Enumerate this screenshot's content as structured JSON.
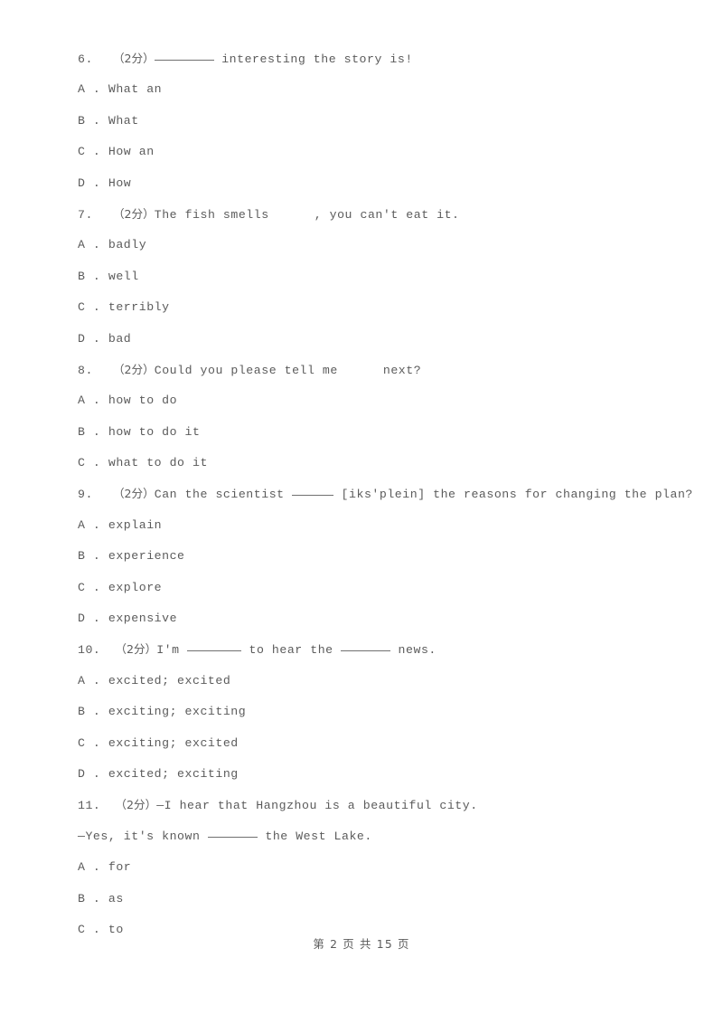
{
  "document": {
    "type": "exam-paper",
    "language": "zh-CN/en",
    "background_color": "#ffffff",
    "text_color": "#5b5b5b"
  },
  "questions": [
    {
      "number": "6.",
      "marks": "（2分）",
      "stem_before": "",
      "blank": "underline",
      "stem_after": " interesting the story is!",
      "options": [
        {
          "letter": "A",
          "sep": " . ",
          "text": "What an"
        },
        {
          "letter": "B",
          "sep": " . ",
          "text": "What"
        },
        {
          "letter": "C",
          "sep": " . ",
          "text": "How an"
        },
        {
          "letter": "D",
          "sep": " . ",
          "text": "How"
        }
      ]
    },
    {
      "number": "7.",
      "marks": "（2分）",
      "stem_before": "The fish smells",
      "blank": "space",
      "stem_after": ", you can't eat it.",
      "options": [
        {
          "letter": "A",
          "sep": " . ",
          "text": "badly"
        },
        {
          "letter": "B",
          "sep": " . ",
          "text": "well"
        },
        {
          "letter": "C",
          "sep": " . ",
          "text": "terribly"
        },
        {
          "letter": "D",
          "sep": " . ",
          "text": "bad"
        }
      ]
    },
    {
      "number": "8.",
      "marks": "（2分）",
      "stem_before": "Could you please tell me",
      "blank": "space",
      "stem_after": "next?",
      "options": [
        {
          "letter": "A",
          "sep": " . ",
          "text": "how to do"
        },
        {
          "letter": "B",
          "sep": " . ",
          "text": "how to do it"
        },
        {
          "letter": "C",
          "sep": " . ",
          "text": "what to do it"
        }
      ]
    },
    {
      "number": "9.",
      "marks": "（2分）",
      "stem_before": "Can the scientist ",
      "blank": "underline",
      "stem_after": " [iks'plein] the reasons for changing the plan?",
      "options": [
        {
          "letter": "A",
          "sep": " . ",
          "text": "explain"
        },
        {
          "letter": "B",
          "sep": " . ",
          "text": "experience"
        },
        {
          "letter": "C",
          "sep": " . ",
          "text": "explore"
        },
        {
          "letter": "D",
          "sep": " . ",
          "text": "expensive"
        }
      ]
    },
    {
      "number": "10.",
      "marks": "（2分）",
      "stem_before": "I'm ",
      "blank": "underline",
      "stem_mid": " to hear the ",
      "blank2": "underline",
      "stem_after": " news.",
      "options": [
        {
          "letter": "A",
          "sep": " . ",
          "text": "excited; excited"
        },
        {
          "letter": "B",
          "sep": " . ",
          "text": "exciting; exciting"
        },
        {
          "letter": "C",
          "sep": " . ",
          "text": "exciting; excited"
        },
        {
          "letter": "D",
          "sep": " . ",
          "text": "excited; exciting"
        }
      ]
    },
    {
      "number": "11.",
      "marks": "（2分）",
      "stem_before": "—I hear that Hangzhou is a beautiful city.",
      "line2_before": "—Yes, it's known ",
      "blank": "underline",
      "line2_after": " the West Lake.",
      "options": [
        {
          "letter": "A",
          "sep": " . ",
          "text": "for"
        },
        {
          "letter": "B",
          "sep": " . ",
          "text": "as"
        },
        {
          "letter": "C",
          "sep": " . ",
          "text": "to"
        }
      ]
    }
  ],
  "footer": {
    "text": "第 2 页 共 15 页"
  }
}
